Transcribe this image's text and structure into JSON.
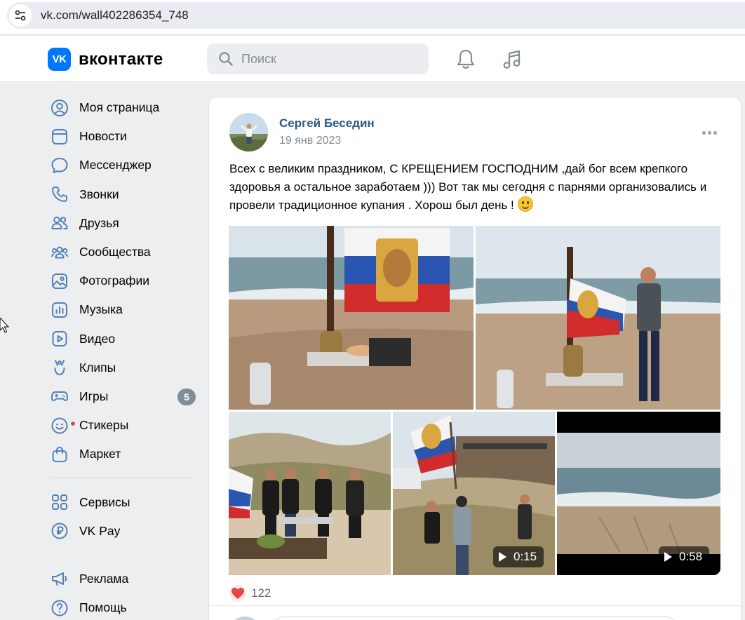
{
  "browser": {
    "url": "vk.com/wall402286354_748",
    "site_info_icon": "tune-icon"
  },
  "header": {
    "logo_mark": "VK",
    "logo_text": "вконтакте",
    "search_placeholder": "Поиск",
    "notifications_icon": "bell-icon",
    "music_icon": "music-note-icon",
    "accent_color": "#0077ff"
  },
  "nav": {
    "items": [
      {
        "label": "Моя страница",
        "icon": "user-circle-icon"
      },
      {
        "label": "Новости",
        "icon": "news-icon"
      },
      {
        "label": "Мессенджер",
        "icon": "chat-bubble-icon"
      },
      {
        "label": "Звонки",
        "icon": "phone-icon"
      },
      {
        "label": "Друзья",
        "icon": "friends-icon"
      },
      {
        "label": "Сообщества",
        "icon": "communities-icon"
      },
      {
        "label": "Фотографии",
        "icon": "photo-icon"
      },
      {
        "label": "Музыка",
        "icon": "music-icon"
      },
      {
        "label": "Видео",
        "icon": "video-icon"
      },
      {
        "label": "Клипы",
        "icon": "clips-icon"
      },
      {
        "label": "Игры",
        "icon": "gamepad-icon",
        "badge": "5"
      },
      {
        "label": "Стикеры",
        "icon": "sticker-icon"
      },
      {
        "label": "Маркет",
        "icon": "market-bag-icon"
      }
    ],
    "secondary": [
      {
        "label": "Сервисы",
        "icon": "services-grid-icon"
      },
      {
        "label": "VK Pay",
        "icon": "vk-pay-icon"
      }
    ],
    "tertiary": [
      {
        "label": "Реклама",
        "icon": "megaphone-icon"
      },
      {
        "label": "Помощь",
        "icon": "help-icon"
      }
    ]
  },
  "post": {
    "author": "Сергей Беседин",
    "date": "19 янв 2023",
    "text": "Всех с великим праздником, С КРЕЩЕНИЕМ ГОСПОДНИМ ,дай бог всем крепкого здоровья а остальное заработаем ))) Вот так мы сегодня с парнями организовались и провели традиционное купания . Хорош был день !",
    "emoji": "slightly-smiling-face",
    "media": [
      {
        "kind": "photo",
        "name": "photo-flag-samovar"
      },
      {
        "kind": "photo",
        "name": "photo-man-with-flag"
      },
      {
        "kind": "photo",
        "name": "photo-group-on-beach"
      },
      {
        "kind": "video",
        "name": "video-flag-waving",
        "duration": "0:15"
      },
      {
        "kind": "video",
        "name": "video-sea-shore",
        "duration": "0:58"
      }
    ],
    "likes": "122",
    "like_color": "#e64646"
  }
}
